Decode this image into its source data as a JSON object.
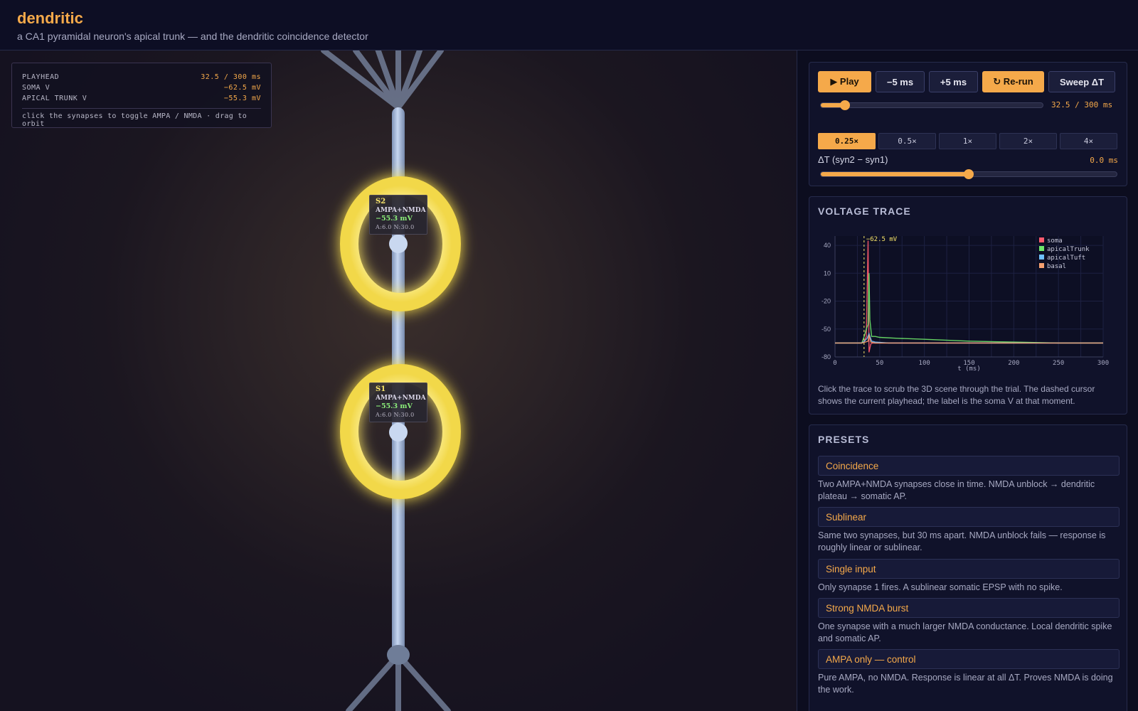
{
  "app": {
    "title": "dendritic",
    "subtitle": "a CA1 pyramidal neuron's apical trunk — and the dendritic coincidence detector"
  },
  "hud": {
    "rows": [
      {
        "label": "PLAYHEAD",
        "value": "32.5 / 300 ms"
      },
      {
        "label": "SOMA V",
        "value": "−62.5 mV"
      },
      {
        "label": "APICAL TRUNK V",
        "value": "−55.3 mV"
      }
    ],
    "hint": "click the synapses to toggle AMPA / NMDA · drag to orbit"
  },
  "synapses": [
    {
      "name": "S2",
      "kind": "AMPA+NMDA",
      "voltage": "−55.3 mV",
      "conductance": "A:6.0 N:30.0"
    },
    {
      "name": "S1",
      "kind": "AMPA+NMDA",
      "voltage": "−55.3 mV",
      "conductance": "A:6.0 N:30.0"
    }
  ],
  "controls": {
    "play_label": "▶ Play",
    "minus_label": "−5 ms",
    "plus_label": "+5 ms",
    "rerun_label": "↻ Re-run",
    "sweep_label": "Sweep ΔT",
    "playhead_readout": "32.5 / 300 ms",
    "playhead_fraction": 0.108,
    "speeds": [
      "0.25×",
      "0.5×",
      "1×",
      "2×",
      "4×"
    ],
    "active_speed": "0.25×",
    "delta_label": "ΔT (syn2 − syn1)",
    "delta_readout": "0.0 ms",
    "delta_fraction": 0.5
  },
  "trace": {
    "title": "VOLTAGE TRACE",
    "cursor_label": "−62.5 mV",
    "caption": "Click the trace to scrub the 3D scene through the trial. The dashed cursor shows the current playhead; the label is the soma V at that moment."
  },
  "chart_data": {
    "type": "line",
    "xlabel": "t (ms)",
    "ylabel": "",
    "xlim": [
      0,
      300
    ],
    "ylim": [
      -80,
      50
    ],
    "xticks": [
      0,
      50,
      100,
      150,
      200,
      250,
      300
    ],
    "yticks": [
      40,
      10,
      -20,
      -50,
      -80
    ],
    "grid": true,
    "legend_position": "top-right",
    "cursor_x": 32.5,
    "series": [
      {
        "name": "soma",
        "color": "#ff5a6e",
        "x": [
          0,
          30,
          33,
          35,
          37,
          38,
          40,
          42,
          45,
          50,
          70,
          100,
          150,
          200,
          250,
          300
        ],
        "y": [
          -65,
          -65,
          -63,
          -58,
          45,
          -75,
          -66,
          -65,
          -65,
          -65,
          -65,
          -65,
          -65,
          -65,
          -65,
          -65
        ]
      },
      {
        "name": "apicalTrunk",
        "color": "#6ee86a",
        "x": [
          0,
          30,
          32,
          35,
          37,
          38,
          39,
          41,
          45,
          50,
          70,
          100,
          150,
          200,
          250,
          300
        ],
        "y": [
          -65,
          -65,
          -60,
          -50,
          -45,
          10,
          -40,
          -58,
          -58,
          -59,
          -60,
          -61,
          -63,
          -64,
          -65,
          -65
        ]
      },
      {
        "name": "apicalTuft",
        "color": "#6ec0ff",
        "x": [
          0,
          30,
          33,
          36,
          38,
          41,
          45,
          60,
          100,
          150,
          200,
          300
        ],
        "y": [
          -65,
          -65,
          -63,
          -60,
          -55,
          -63,
          -64,
          -65,
          -65,
          -65,
          -65,
          -65
        ]
      },
      {
        "name": "basal",
        "color": "#f5a070",
        "x": [
          0,
          30,
          34,
          37,
          38,
          40,
          45,
          60,
          100,
          150,
          200,
          300
        ],
        "y": [
          -65,
          -65,
          -64,
          -63,
          -56,
          -64,
          -65,
          -65,
          -65,
          -65,
          -65,
          -65
        ]
      }
    ]
  },
  "presets": {
    "title": "PRESETS",
    "items": [
      {
        "label": "Coincidence",
        "desc": "Two AMPA+NMDA synapses close in time. NMDA unblock → dendritic plateau → somatic AP."
      },
      {
        "label": "Sublinear",
        "desc": "Same two synapses, but 30 ms apart. NMDA unblock fails — response is roughly linear or sublinear."
      },
      {
        "label": "Single input",
        "desc": "Only synapse 1 fires. A sublinear somatic EPSP with no spike."
      },
      {
        "label": "Strong NMDA burst",
        "desc": "One synapse with a much larger NMDA conductance. Local dendritic spike and somatic AP."
      },
      {
        "label": "AMPA only — control",
        "desc": "Pure AMPA, no NMDA. Response is linear at all ΔT. Proves NMDA is doing the work."
      }
    ]
  },
  "colors": {
    "accent": "#f5a94a",
    "synapse_glow": "#ffee6a",
    "dendrite": "#a9c2e6",
    "panel_bg": "#10122a"
  }
}
